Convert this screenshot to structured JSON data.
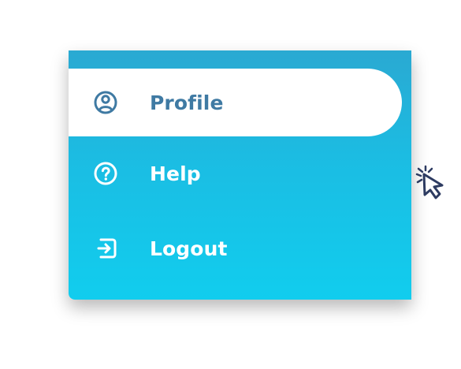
{
  "menu": {
    "items": [
      {
        "label": "Profile",
        "icon": "user-circle-icon",
        "active": true
      },
      {
        "label": "Help",
        "icon": "question-circle-icon",
        "active": false
      },
      {
        "label": "Logout",
        "icon": "logout-icon",
        "active": false
      }
    ]
  },
  "colors": {
    "panel_gradient_top": "#2aa9d2",
    "panel_gradient_bottom": "#11cdee",
    "active_text": "#3f7aa3",
    "inactive_text": "#ffffff",
    "active_background": "#ffffff"
  }
}
